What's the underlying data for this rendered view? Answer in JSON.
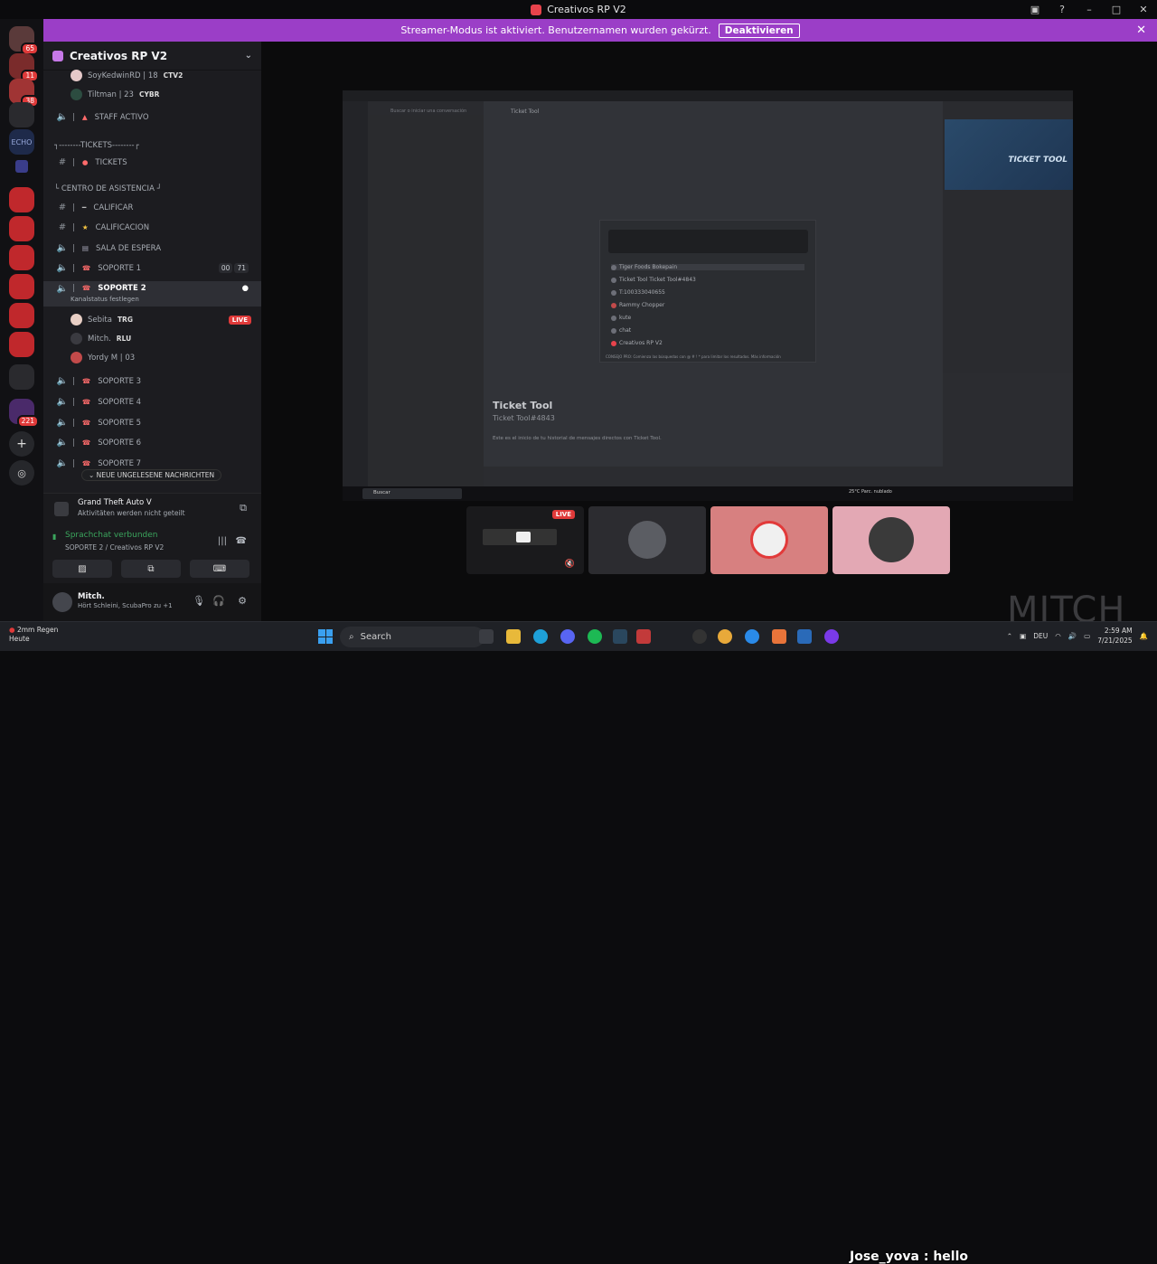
{
  "window": {
    "title": "Creativos RP V2",
    "controls": [
      "▣",
      "?",
      "–",
      "□",
      "✕"
    ]
  },
  "streamer_bar": {
    "text": "Streamer-Modus ist aktiviert. Benutzernamen wurden gekürzt.",
    "button": "Deaktivieren"
  },
  "guild_rail": {
    "badges": [
      "65",
      "11",
      "38",
      "221"
    ]
  },
  "server": {
    "name": "Creativos RP V2"
  },
  "sidebar": {
    "top_users": [
      {
        "name": "SoyKedwinRD | 18",
        "tag": "CTV2"
      },
      {
        "name": "Tiltman | 23",
        "tag": "CYBR"
      }
    ],
    "staff_channel": "STAFF ACTIVO",
    "tickets_category": "┐--------TICKETS--------┌",
    "tickets_channel": "TICKETS",
    "help_category": "└ CENTRO DE ASISTENCIA ┘",
    "calificar": "CALIFICAR",
    "calificacion": "CALIFICACION",
    "sala": "SALA DE ESPERA",
    "soporte1": "SOPORTE 1",
    "soporte1_counts": [
      "00",
      "71"
    ],
    "soporte2": "SOPORTE 2",
    "soporte2_status": "Kanalstatus festlegen",
    "voice_users": [
      {
        "name": "Sebita",
        "tag": "TRG",
        "live": "LIVE"
      },
      {
        "name": "Mitch.",
        "tag": "RLU"
      },
      {
        "name": "Yordy M | 03",
        "tag": ""
      }
    ],
    "soporte3": "SOPORTE 3",
    "soporte4": "SOPORTE 4",
    "soporte5": "SOPORTE 5",
    "soporte6": "SOPORTE 6",
    "soporte7": "SOPORTE 7",
    "unread_pill": "NEUE UNGELESENE NACHRICHTEN"
  },
  "activity": {
    "game": "Grand Theft Auto V",
    "note": "Aktivitäten werden nicht geteilt"
  },
  "voice": {
    "status": "Sprachchat verbunden",
    "channel": "SOPORTE 2 / Creativos RP V2"
  },
  "user": {
    "name": "Mitch.",
    "status": "Hört Schleini, ScubaPro zu +1"
  },
  "shared_screen": {
    "search_placeholder": "Buscar o iniciar una conversación",
    "channel_title": "Ticket Tool",
    "bot_name": "Ticket Tool",
    "bot_tag": "Ticket Tool#4843",
    "intro": "Este es el inicio de tu historial de mensajes directos con Ticket Tool.",
    "quick_items": [
      "Tiger Foods Bokepain",
      "Ticket Tool  Ticket Tool#4843",
      "T:100333040655",
      "Rammy Chopper",
      "kute",
      "chat",
      "Creativos RP V2"
    ],
    "quick_tip": "CONSEJO PRO: Comienza las búsquedas con @ # ! * para limitar los resultados. Más información",
    "banner": "TICKET TOOL",
    "taskbar_search": "Buscar",
    "weather": "25°C  Parc. nublado"
  },
  "stream_tile": {
    "live": "LIVE"
  },
  "watermark": "MITCH",
  "taskbar": {
    "notification_title": "2mm Regen",
    "notification_sub": "Heute",
    "search": "Search",
    "chat_overlay": "Jose_yova : hello",
    "lang": "DEU",
    "time": "2:59 AM",
    "date": "7/21/2025"
  }
}
